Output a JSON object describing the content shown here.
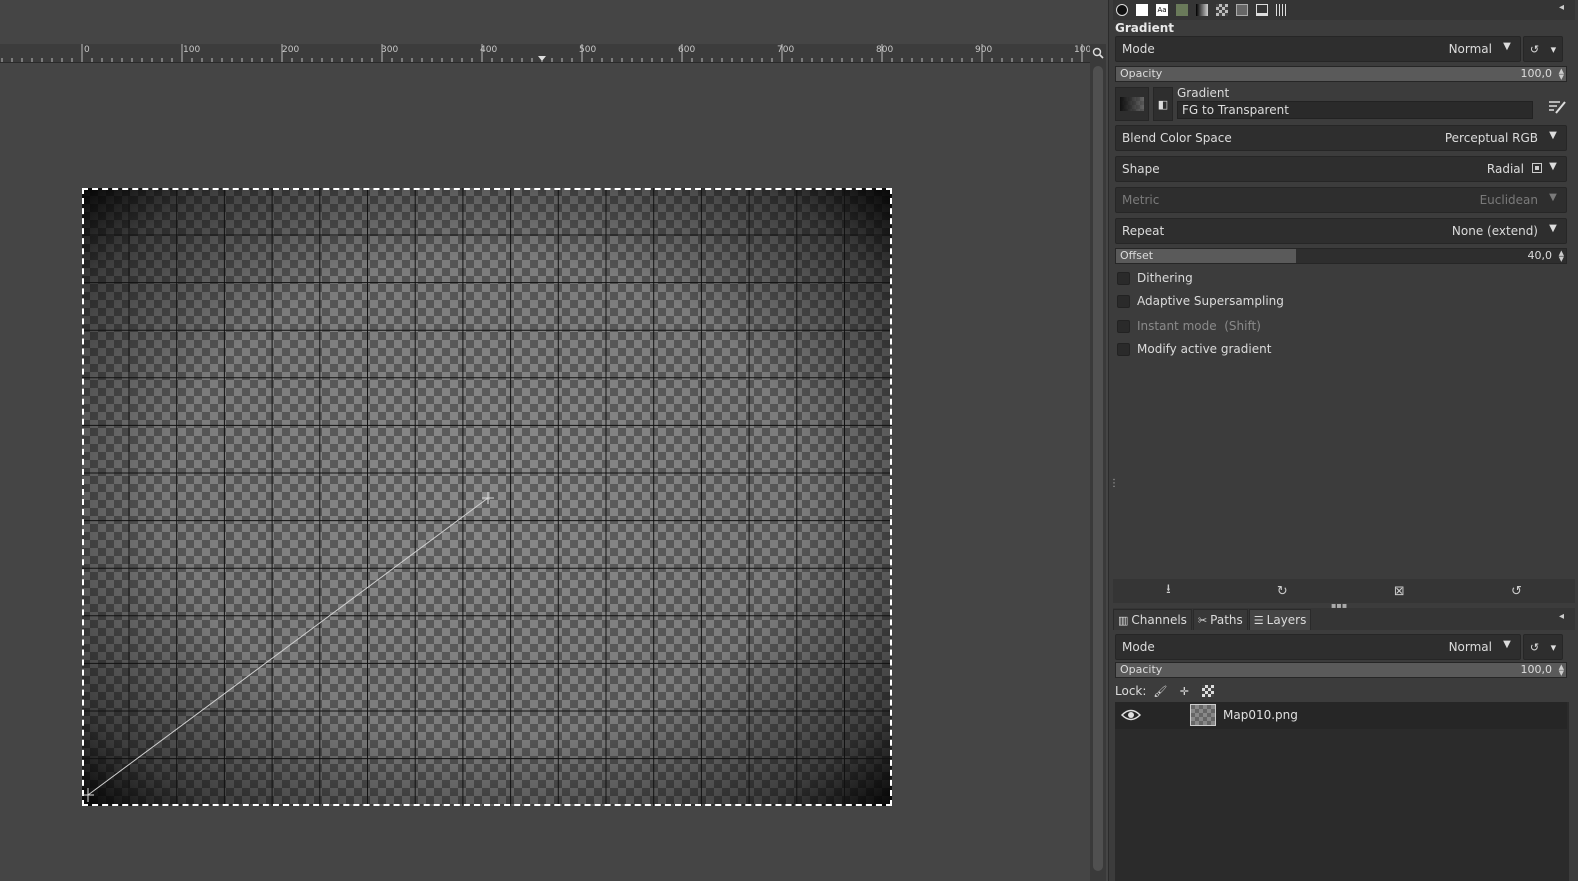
{
  "ruler": {
    "labels": [
      "0",
      "100",
      "200",
      "300",
      "400",
      "500",
      "600",
      "700",
      "800",
      "900",
      "100"
    ]
  },
  "tool_options": {
    "title": "Gradient",
    "mode": {
      "label": "Mode",
      "value": "Normal"
    },
    "opacity": {
      "label": "Opacity",
      "value": "100,0",
      "fraction": 1.0
    },
    "gradient": {
      "label": "Gradient",
      "name": "FG to Transparent"
    },
    "blend_color_space": {
      "label": "Blend Color Space",
      "value": "Perceptual RGB"
    },
    "shape": {
      "label": "Shape",
      "value": "Radial"
    },
    "metric": {
      "label": "Metric",
      "value": "Euclidean"
    },
    "repeat": {
      "label": "Repeat",
      "value": "None (extend)"
    },
    "offset": {
      "label": "Offset",
      "value": "40,0",
      "fraction": 0.4
    },
    "checkboxes": {
      "dithering": "Dithering",
      "adaptive": "Adaptive Supersampling",
      "instant": "Instant mode  (Shift)",
      "modify": "Modify active gradient"
    }
  },
  "layers_panel": {
    "tabs": {
      "channels": "Channels",
      "paths": "Paths",
      "layers": "Layers"
    },
    "mode": {
      "label": "Mode",
      "value": "Normal"
    },
    "opacity": {
      "label": "Opacity",
      "value": "100,0",
      "fraction": 1.0
    },
    "lock_label": "Lock:",
    "layer_name": "Map010.png"
  },
  "icons": {
    "tool_tabs": [
      "paintbrush-icon",
      "white-swatch-icon",
      "text-icon",
      "image-icon",
      "gradient-icon",
      "patterns-icon",
      "fonts-icon",
      "document-icon",
      "grid-icon"
    ]
  }
}
